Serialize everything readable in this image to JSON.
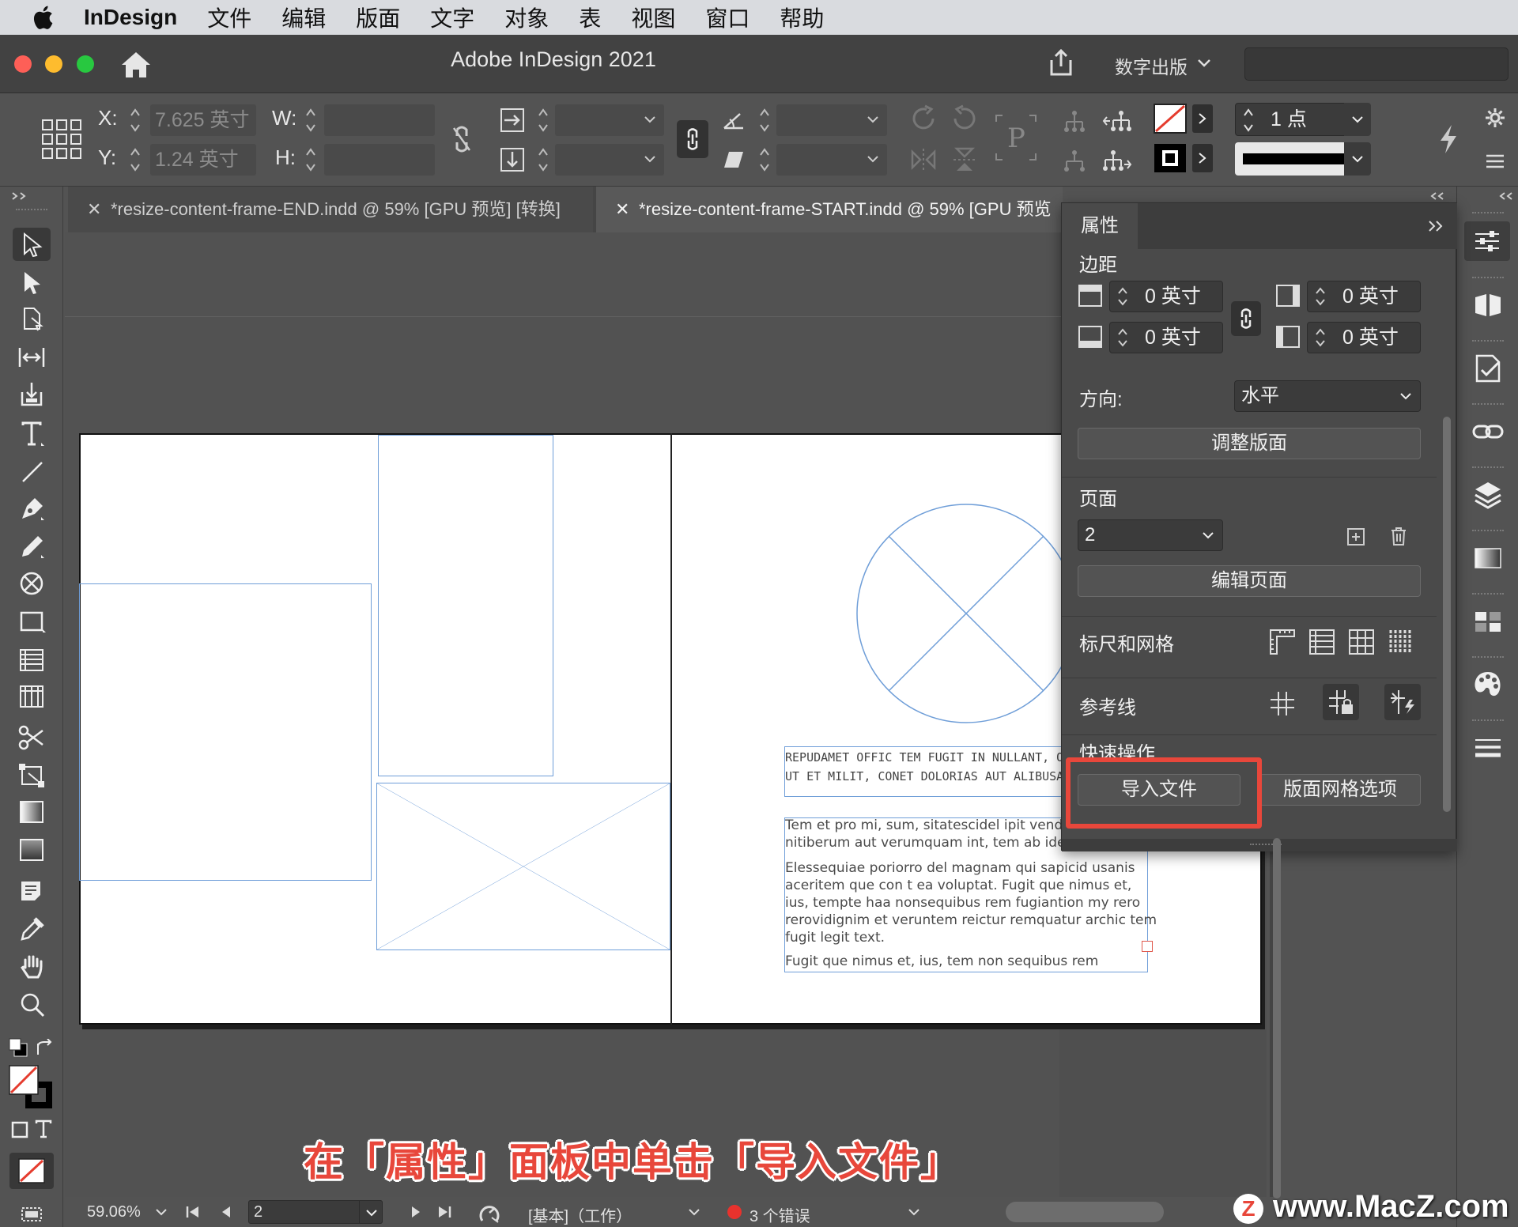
{
  "menubar": {
    "app_name": "InDesign",
    "items": [
      "文件",
      "编辑",
      "版面",
      "文字",
      "对象",
      "表",
      "视图",
      "窗口",
      "帮助"
    ]
  },
  "titlebar": {
    "title": "Adobe InDesign 2021",
    "workspace": "数字出版"
  },
  "control": {
    "x_label": "X:",
    "x_value": "7.625 英寸",
    "y_label": "Y:",
    "y_value": "1.24 英寸",
    "w_label": "W:",
    "h_label": "H:",
    "stroke_weight": "1 点"
  },
  "tabs": [
    {
      "label": "*resize-content-frame-END.indd @ 59% [GPU 预览] [转换]"
    },
    {
      "label": "*resize-content-frame-START.indd @ 59% [GPU 预览"
    }
  ],
  "properties": {
    "tab_label": "属性",
    "margins_label": "边距",
    "margin_top": "0 英寸",
    "margin_bottom": "0 英寸",
    "margin_right": "0 英寸",
    "margin_left": "0 英寸",
    "orientation_label": "方向:",
    "orientation_value": "水平",
    "adjust_layout_button": "调整版面",
    "pages_label": "页面",
    "page_value": "2",
    "edit_page_button": "编辑页面",
    "rulers_grids_label": "标尺和网格",
    "guides_label": "参考线",
    "quick_actions_label": "快速操作",
    "import_file_button": "导入文件",
    "layout_grid_options_button": "版面网格选项"
  },
  "document": {
    "caps_line_1": "REPUDAMET OFFIC TEM FUGIT IN NULLANT, OF",
    "caps_line_2": "UT ET MILIT, CONET DOLORIAS AUT ALIBUSAE",
    "body_lines": [
      "Tem et pro mi, sum, sitatescidel ipit venda",
      "nitiberum aut verumquam int, tem ab idem",
      "Elessequiae poriorro del magnam qui sapicid usanis",
      "aceritem que con t ea voluptat. Fugit que nimus et,",
      "ius, tempte haa nonsequibus rem fugiantion my rero",
      "rerovidignim et veruntem reictur remquatur archic tem",
      "fugit legit text.",
      "Fugit que nimus et, ius, tem non sequibus rem"
    ]
  },
  "statusbar": {
    "zoom": "59.06%",
    "page": "2",
    "preflight_profile": "[基本]（工作）",
    "errors": "3 个错误"
  },
  "subtitle": "在「属性」面板中单击「导入文件」",
  "watermark": "www.MacZ.com",
  "watermark_logo": "Z",
  "colors": {
    "highlight": "#e8473b",
    "frame_blue": "#6f9ed8",
    "panel_bg": "#4a4a4a"
  }
}
